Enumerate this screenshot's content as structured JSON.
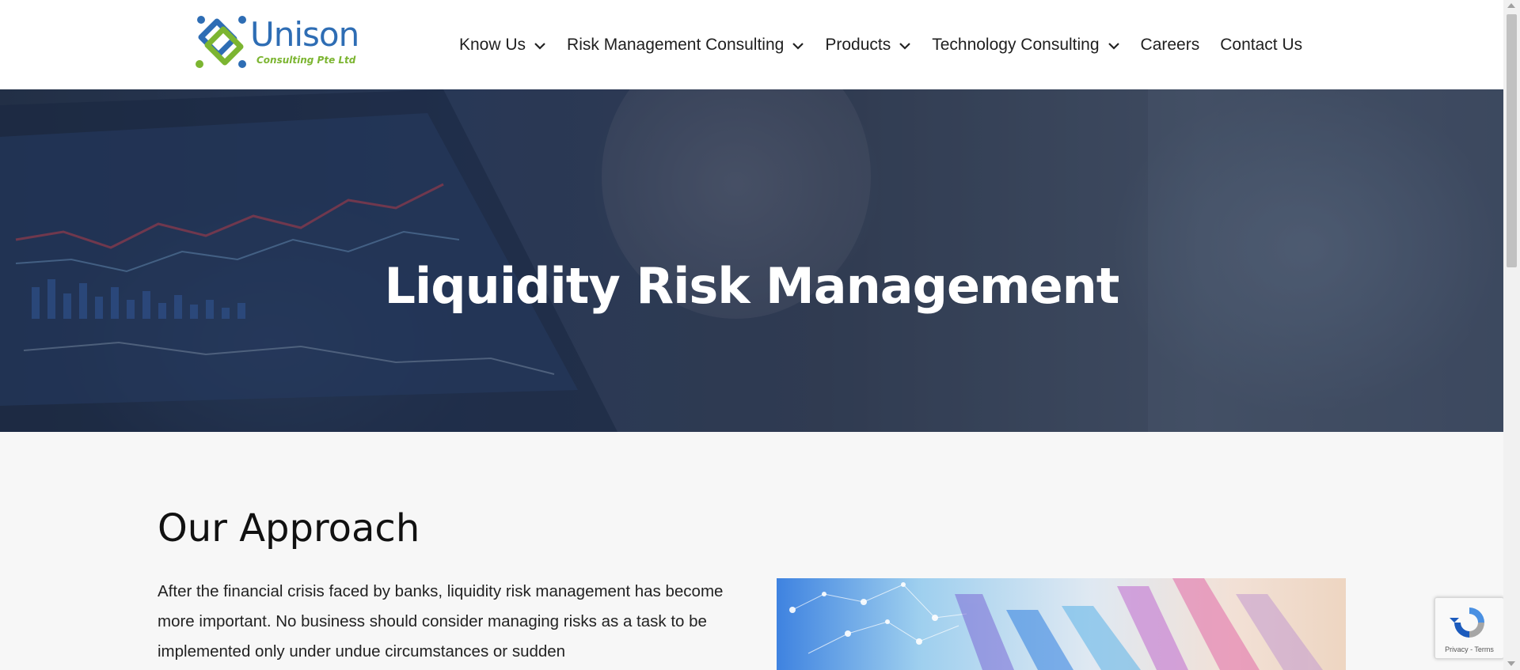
{
  "logo": {
    "name": "Unison",
    "tagline": "Consulting Pte Ltd"
  },
  "nav": [
    {
      "label": "Know Us",
      "has_dropdown": true
    },
    {
      "label": "Risk Management Consulting",
      "has_dropdown": true
    },
    {
      "label": "Products",
      "has_dropdown": true
    },
    {
      "label": "Technology Consulting",
      "has_dropdown": true
    },
    {
      "label": "Careers",
      "has_dropdown": false
    },
    {
      "label": "Contact Us",
      "has_dropdown": false
    }
  ],
  "hero": {
    "title": "Liquidity Risk Management"
  },
  "approach": {
    "heading": "Our Approach",
    "text": "After the financial crisis faced by banks, liquidity risk management has become more important. No business should consider managing risks as a task to be implemented only under undue circumstances or sudden"
  },
  "recaptcha": {
    "links": "Privacy - Terms"
  },
  "colors": {
    "brand_blue": "#2e6db4",
    "brand_green": "#7cb531"
  }
}
